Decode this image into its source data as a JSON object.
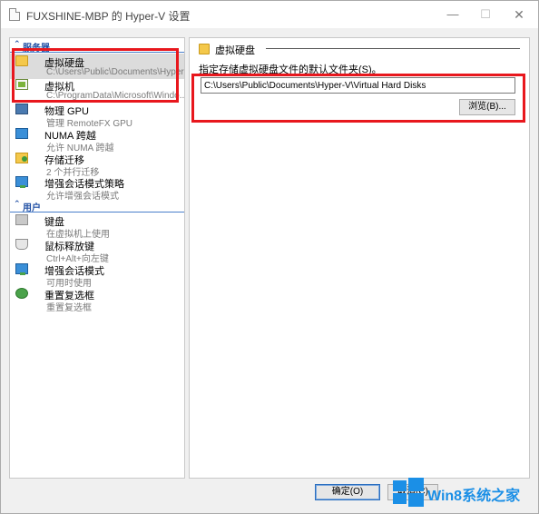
{
  "window": {
    "title": "FUXSHINE-MBP 的 Hyper-V 设置"
  },
  "nav": {
    "server_header": "服务器",
    "user_header": "用户",
    "server_items": [
      {
        "title": "虚拟硬盘",
        "subtitle": "C:\\Users\\Public\\Documents\\Hyper-...",
        "icon": "folder-icon"
      },
      {
        "title": "虚拟机",
        "subtitle": "C:\\ProgramData\\Microsoft\\Windo...",
        "icon": "vm-icon"
      },
      {
        "title": "物理 GPU",
        "subtitle": "管理 RemoteFX GPU",
        "icon": "gpu-icon"
      },
      {
        "title": "NUMA 跨越",
        "subtitle": "允许 NUMA 跨越",
        "icon": "numa-icon"
      },
      {
        "title": "存储迁移",
        "subtitle": "2 个并行迁移",
        "icon": "storage-migration-icon"
      },
      {
        "title": "增强会话模式策略",
        "subtitle": "允许增强会话模式",
        "icon": "enhanced-session-icon"
      }
    ],
    "user_items": [
      {
        "title": "键盘",
        "subtitle": "在虚拟机上使用",
        "icon": "keyboard-icon"
      },
      {
        "title": "鼠标释放键",
        "subtitle": "Ctrl+Alt+向左键",
        "icon": "mouse-icon"
      },
      {
        "title": "增强会话模式",
        "subtitle": "可用时使用",
        "icon": "enhanced-session-icon"
      },
      {
        "title": "重置复选框",
        "subtitle": "重置复选框",
        "icon": "reset-icon"
      }
    ]
  },
  "content": {
    "header_title": "虚拟硬盘",
    "field_label": "指定存储虚拟硬盘文件的默认文件夹(S)。",
    "path_value": "C:\\Users\\Public\\Documents\\Hyper-V\\Virtual Hard Disks",
    "browse_label": "浏览(B)..."
  },
  "footer": {
    "ok_label": "确定(O)",
    "cancel_label": "取消(C)"
  },
  "watermark": {
    "text": "Win8系统之家"
  },
  "colors": {
    "highlight": "#e8171d",
    "section_header": "#1f4ea3",
    "watermark": "#1b8fe6"
  }
}
